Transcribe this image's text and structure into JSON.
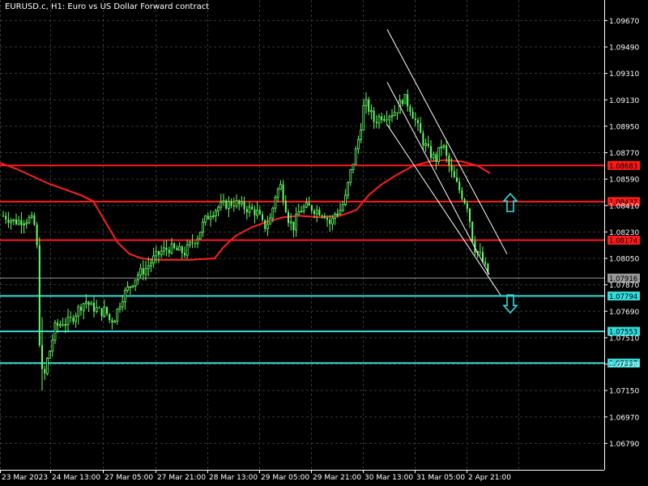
{
  "window": {
    "title": "EURUSD.c, H1:  Euro vs US Dollar Forward contract"
  },
  "colors": {
    "background": "#000000",
    "grid": "#2a3f2a",
    "candle": "#66ff66",
    "moving_average": "#ff2020",
    "resistance": "#ff1a1a",
    "support": "#33dddd",
    "channel": "#ffffff",
    "current_price": "#9a9a9a",
    "arrow": "#33dddd"
  },
  "chart_data": {
    "type": "candlestick",
    "symbol": "EURUSD.c",
    "timeframe": "H1",
    "ylim": [
      1.0661,
      1.0981
    ],
    "grid": true,
    "y_ticks": [
      1.0967,
      1.0949,
      1.0931,
      1.0913,
      1.0895,
      1.0877,
      1.0859,
      1.0841,
      1.0823,
      1.0805,
      1.0787,
      1.0769,
      1.0751,
      1.0733,
      1.0715,
      1.0697,
      1.0679
    ],
    "y_tick_labels": [
      "1.09670",
      "1.09490",
      "1.09310",
      "1.09130",
      "1.08950",
      "1.08770",
      "1.08590",
      "1.08410",
      "1.08230",
      "1.08050",
      "1.07870",
      "1.07690",
      "1.07510",
      "1.07330",
      "1.07150",
      "1.06970",
      "1.06790"
    ],
    "x_tick_labels": [
      "23 Mar 2023",
      "24 Mar 13:00",
      "27 Mar 05:00",
      "27 Mar 21:00",
      "28 Mar 13:00",
      "29 Mar 05:00",
      "29 Mar 21:00",
      "30 Mar 13:00",
      "31 Mar 05:00",
      "2 Apr 21:00"
    ],
    "close_path": [
      [
        0,
        1.0835
      ],
      [
        8,
        1.0833
      ],
      [
        18,
        1.083
      ],
      [
        28,
        1.0831
      ],
      [
        38,
        1.0832
      ],
      [
        45,
        1.0825
      ],
      [
        48,
        1.076
      ],
      [
        50,
        1.0732
      ],
      [
        54,
        1.0722
      ],
      [
        58,
        1.0735
      ],
      [
        62,
        1.0743
      ],
      [
        68,
        1.0758
      ],
      [
        76,
        1.0761
      ],
      [
        86,
        1.0762
      ],
      [
        94,
        1.0768
      ],
      [
        100,
        1.0773
      ],
      [
        106,
        1.0776
      ],
      [
        112,
        1.0772
      ],
      [
        118,
        1.0771
      ],
      [
        124,
        1.0768
      ],
      [
        130,
        1.077
      ],
      [
        136,
        1.0762
      ],
      [
        142,
        1.0765
      ],
      [
        150,
        1.0778
      ],
      [
        160,
        1.0786
      ],
      [
        170,
        1.0794
      ],
      [
        180,
        1.0798
      ],
      [
        190,
        1.0805
      ],
      [
        200,
        1.081
      ],
      [
        210,
        1.0812
      ],
      [
        220,
        1.081
      ],
      [
        228,
        1.0809
      ],
      [
        236,
        1.0815
      ],
      [
        244,
        1.082
      ],
      [
        252,
        1.083
      ],
      [
        260,
        1.0836
      ],
      [
        270,
        1.084
      ],
      [
        280,
        1.0842
      ],
      [
        290,
        1.0843
      ],
      [
        300,
        1.084
      ],
      [
        310,
        1.0838
      ],
      [
        318,
        1.0836
      ],
      [
        326,
        1.0826
      ],
      [
        334,
        1.0832
      ],
      [
        340,
        1.0848
      ],
      [
        346,
        1.0855
      ],
      [
        350,
        1.0847
      ],
      [
        356,
        1.0832
      ],
      [
        362,
        1.0826
      ],
      [
        370,
        1.0838
      ],
      [
        380,
        1.084
      ],
      [
        390,
        1.0838
      ],
      [
        400,
        1.0836
      ],
      [
        408,
        1.0828
      ],
      [
        414,
        1.0836
      ],
      [
        420,
        1.0838
      ],
      [
        426,
        1.0845
      ],
      [
        432,
        1.0862
      ],
      [
        438,
        1.0875
      ],
      [
        444,
        1.089
      ],
      [
        450,
        1.0912
      ],
      [
        456,
        1.0906
      ],
      [
        462,
        1.0898
      ],
      [
        470,
        1.0902
      ],
      [
        480,
        1.0903
      ],
      [
        490,
        1.0906
      ],
      [
        498,
        1.0915
      ],
      [
        506,
        1.0908
      ],
      [
        514,
        1.0897
      ],
      [
        522,
        1.0885
      ],
      [
        530,
        1.0877
      ],
      [
        538,
        1.0872
      ],
      [
        546,
        1.0884
      ],
      [
        552,
        1.0872
      ],
      [
        558,
        1.0862
      ],
      [
        566,
        1.0853
      ],
      [
        572,
        1.0846
      ],
      [
        578,
        1.084
      ],
      [
        582,
        1.0822
      ],
      [
        586,
        1.0812
      ],
      [
        592,
        1.0808
      ],
      [
        598,
        1.08
      ],
      [
        605,
        1.0792
      ]
    ],
    "moving_average": [
      [
        0,
        1.087
      ],
      [
        20,
        1.0866
      ],
      [
        40,
        1.0861
      ],
      [
        60,
        1.0856
      ],
      [
        80,
        1.0852
      ],
      [
        100,
        1.0848
      ],
      [
        115,
        1.0844
      ],
      [
        130,
        1.083
      ],
      [
        145,
        1.0816
      ],
      [
        160,
        1.0808
      ],
      [
        175,
        1.0805
      ],
      [
        190,
        1.0804
      ],
      [
        210,
        1.0804
      ],
      [
        235,
        1.0804
      ],
      [
        265,
        1.0805
      ],
      [
        275,
        1.0812
      ],
      [
        290,
        1.082
      ],
      [
        310,
        1.0826
      ],
      [
        330,
        1.083
      ],
      [
        350,
        1.0833
      ],
      [
        370,
        1.0834
      ],
      [
        395,
        1.0833
      ],
      [
        420,
        1.0834
      ],
      [
        440,
        1.0838
      ],
      [
        455,
        1.0848
      ],
      [
        470,
        1.0855
      ],
      [
        490,
        1.0862
      ],
      [
        510,
        1.0868
      ],
      [
        530,
        1.0871
      ],
      [
        550,
        1.0872
      ],
      [
        570,
        1.0871
      ],
      [
        590,
        1.0868
      ],
      [
        605,
        1.0863
      ]
    ],
    "resistance_levels": [
      {
        "value": 1.08683,
        "label": "1.08683"
      },
      {
        "value": 1.08437,
        "label": "1.08437"
      },
      {
        "value": 1.08174,
        "label": "1.08174"
      }
    ],
    "support_levels": [
      {
        "value": 1.07794,
        "label": "1.07794"
      },
      {
        "value": 1.07553,
        "label": "1.07553"
      },
      {
        "value": 1.07337,
        "label": "1.07337"
      }
    ],
    "current_price": {
      "value": 1.07916,
      "label": "1.07916"
    },
    "channel_lines": [
      {
        "from": [
          478,
          1.0961
        ],
        "to": [
          626,
          1.0808
        ]
      },
      {
        "from": [
          478,
          1.0925
        ],
        "to": [
          604,
          1.0794
        ]
      },
      {
        "from": [
          478,
          1.0896
        ],
        "to": [
          618,
          1.078
        ]
      }
    ],
    "arrows": [
      {
        "direction": "up",
        "x": 630,
        "value": 1.0843
      },
      {
        "direction": "down",
        "x": 630,
        "value": 1.0774
      }
    ]
  }
}
